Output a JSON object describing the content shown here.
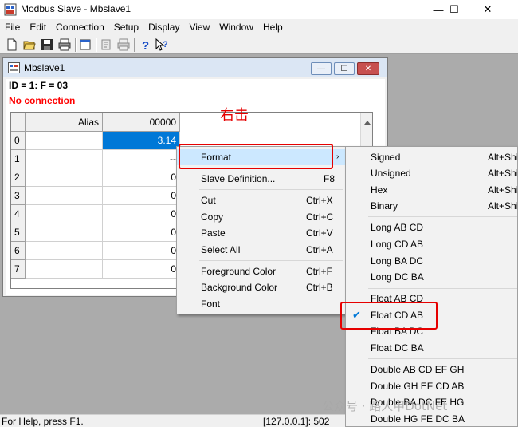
{
  "app": {
    "title": "Modbus Slave - Mbslave1"
  },
  "window_controls": {
    "minimize": "—",
    "maximize": "☐",
    "close": "✕"
  },
  "menubar": [
    "File",
    "Edit",
    "Connection",
    "Setup",
    "Display",
    "View",
    "Window",
    "Help"
  ],
  "toolbar": [
    "new-icon",
    "open-icon",
    "save-icon",
    "print-icon",
    "window-icon",
    "slave-def-icon",
    "print-preview-icon",
    "help-icon",
    "context-help-icon"
  ],
  "child": {
    "title": "Mbslave1",
    "info": "ID = 1: F = 03",
    "status": "No connection",
    "status_color": "#ff0000"
  },
  "grid": {
    "columns": [
      "Alias",
      "00000"
    ],
    "rows": [
      {
        "id": "0",
        "alias": "",
        "value": "3.14",
        "selected": true
      },
      {
        "id": "1",
        "alias": "",
        "value": "--"
      },
      {
        "id": "2",
        "alias": "",
        "value": "0"
      },
      {
        "id": "3",
        "alias": "",
        "value": "0"
      },
      {
        "id": "4",
        "alias": "",
        "value": "0"
      },
      {
        "id": "5",
        "alias": "",
        "value": "0"
      },
      {
        "id": "6",
        "alias": "",
        "value": "0"
      },
      {
        "id": "7",
        "alias": "",
        "value": "0"
      }
    ]
  },
  "annotation": "右击",
  "context_menu": {
    "format": {
      "label": "Format",
      "arrow": "›"
    },
    "slave_def": {
      "label": "Slave Definition...",
      "shortcut": "F8"
    },
    "cut": {
      "label": "Cut",
      "shortcut": "Ctrl+X"
    },
    "copy": {
      "label": "Copy",
      "shortcut": "Ctrl+C"
    },
    "paste": {
      "label": "Paste",
      "shortcut": "Ctrl+V"
    },
    "select_all": {
      "label": "Select All",
      "shortcut": "Ctrl+A"
    },
    "fg_color": {
      "label": "Foreground Color",
      "shortcut": "Ctrl+F"
    },
    "bg_color": {
      "label": "Background Color",
      "shortcut": "Ctrl+B"
    },
    "font": {
      "label": "Font"
    }
  },
  "submenu": {
    "signed": {
      "label": "Signed",
      "shortcut": "Alt+Shi"
    },
    "unsigned": {
      "label": "Unsigned",
      "shortcut": "Alt+Shi"
    },
    "hex": {
      "label": "Hex",
      "shortcut": "Alt+Shi"
    },
    "binary": {
      "label": "Binary",
      "shortcut": "Alt+Shi"
    },
    "long_ab_cd": {
      "label": "Long AB CD"
    },
    "long_cd_ab": {
      "label": "Long CD AB"
    },
    "long_ba_dc": {
      "label": "Long BA DC"
    },
    "long_dc_ba": {
      "label": "Long DC BA"
    },
    "float_ab_cd": {
      "label": "Float AB CD"
    },
    "float_cd_ab": {
      "label": "Float CD AB",
      "checked": true
    },
    "float_ba_dc": {
      "label": "Float BA DC"
    },
    "float_dc_ba": {
      "label": "Float DC BA"
    },
    "double_ab": {
      "label": "Double AB CD EF GH"
    },
    "double_gh": {
      "label": "Double GH EF CD AB"
    },
    "double_ba": {
      "label": "Double BA DC FE HG"
    },
    "double_hg": {
      "label": "Double HG FE DC BA"
    }
  },
  "watermark": "公众号 · 路人甲DotNet",
  "statusbar": {
    "help": "For Help, press F1.",
    "address": "[127.0.0.1]: 502"
  },
  "colors": {
    "accent": "#0078d7",
    "highlight": "#cce8ff",
    "annotation_red": "#e60000"
  }
}
